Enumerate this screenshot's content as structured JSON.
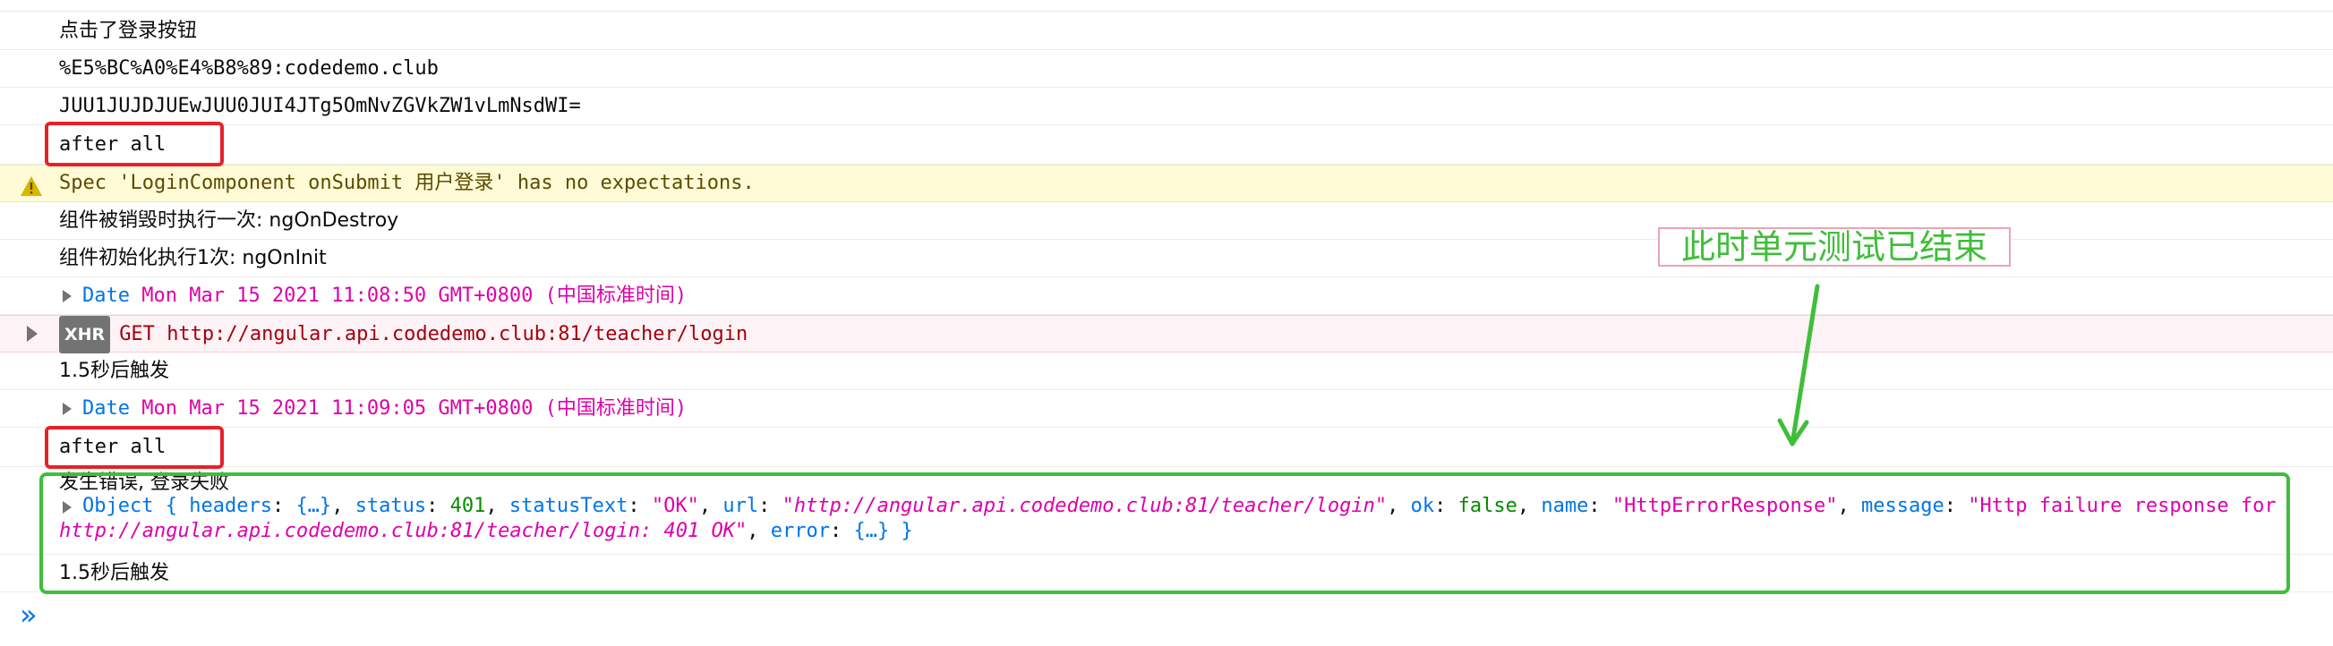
{
  "colors": {
    "highlight_red": "#e8202a",
    "highlight_green": "#3fbe3a",
    "warning_bg": "#fffbd6",
    "error_bg": "#fdf2f5",
    "link_blue": "#0074e8",
    "string_magenta": "#dd00a9",
    "number_green": "#058b00"
  },
  "logs": {
    "r1": "点击了登录按钮",
    "r2": "%E5%BC%A0%E4%B8%89:codedemo.club",
    "r3": "JUU1JUJDJUEwJUU0JUI4JTg5OmNvZGVkZW1vLmNsdWI=",
    "r4": "after all",
    "warn": "Spec 'LoginComponent onSubmit 用户登录' has no expectations.",
    "r6": "组件被销毁时执行一次: ngOnDestroy",
    "r7": "组件初始化执行1次: ngOnInit",
    "date1_label": "Date",
    "date1_value": "Mon Mar 15 2021 11:08:50 GMT+0800 (中国标准时间)",
    "xhr_badge": "XHR",
    "xhr_method": "GET",
    "xhr_url": "http://angular.api.codedemo.club:81/teacher/login",
    "r10": "1.5秒后触发",
    "date2_label": "Date",
    "date2_value": "Mon Mar 15 2021 11:09:05 GMT+0800 (中国标准时间)",
    "r12": "after all",
    "r13a": "发生错误, 登录失败",
    "obj": {
      "p1": "Object { ",
      "headers_key": "headers",
      "headers_val": "{…}",
      "status_key": "status",
      "status_val": "401",
      "statusText_key": "statusText",
      "statusText_val": "\"OK\"",
      "url_key": "url",
      "url_val": "\"http://angular.api.codedemo.club:81/teacher/login\"",
      "ok_key": "ok",
      "ok_val": "false",
      "name_key": "name",
      "name_val": "\"HttpErrorResponse\"",
      "message_key": "message",
      "message_val1": "\"Http failure response for",
      "message_val2": "http://angular.api.codedemo.club:81/teacher/login: 401 OK\"",
      "error_key": "error",
      "error_val": "{…}",
      "close": " }"
    },
    "r14": "1.5秒后触发"
  },
  "annotation": "此时单元测试已结束",
  "prompt_glyph": "»",
  "icons": [
    "warning-icon",
    "expand-triangle-icon",
    "console-prompt-icon"
  ]
}
